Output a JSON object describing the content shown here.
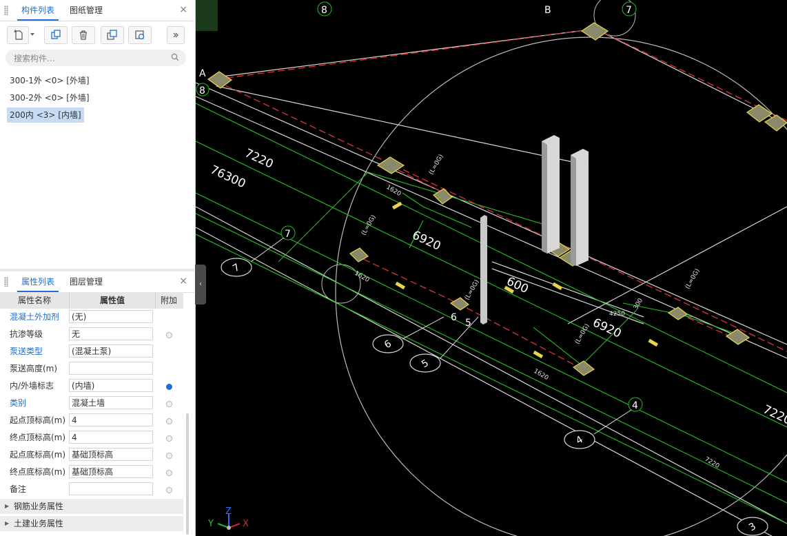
{
  "component_panel": {
    "tabs": [
      "构件列表",
      "图纸管理"
    ],
    "active_tab": 0,
    "close_icon": "×",
    "toolbar": [
      "new-component-icon",
      "dropdown-arrow-icon",
      "copy-icon",
      "delete-icon",
      "duplicate-layer-icon",
      "refresh-icon",
      "more-icon"
    ],
    "search_placeholder": "搜索构件...",
    "items": [
      {
        "label": "300-1外 <0> [外墙]",
        "selected": false
      },
      {
        "label": "300-2外 <0> [外墙]",
        "selected": false
      },
      {
        "label": "200内 <3> [内墙]",
        "selected": true
      }
    ]
  },
  "property_panel": {
    "tabs": [
      "属性列表",
      "图层管理"
    ],
    "active_tab": 0,
    "close_icon": "×",
    "columns": [
      "属性名称",
      "属性值",
      "附加"
    ],
    "rows": [
      {
        "name": "混凝土外加剂",
        "value": "(无)",
        "blue": true,
        "dot": "none"
      },
      {
        "name": "抗渗等级",
        "value": "无",
        "blue": false,
        "dot": "off"
      },
      {
        "name": "泵送类型",
        "value": "(混凝土泵)",
        "blue": true,
        "dot": "none"
      },
      {
        "name": "泵送高度(m)",
        "value": "",
        "blue": false,
        "dot": "none"
      },
      {
        "name": "内/外墙标志",
        "value": "(内墙)",
        "blue": false,
        "dot": "on"
      },
      {
        "name": "类别",
        "value": "混凝土墙",
        "blue": true,
        "dot": "off"
      },
      {
        "name": "起点顶标高(m)",
        "value": "4",
        "blue": false,
        "dot": "off"
      },
      {
        "name": "终点顶标高(m)",
        "value": "4",
        "blue": false,
        "dot": "off"
      },
      {
        "name": "起点底标高(m)",
        "value": "基础顶标高",
        "blue": false,
        "dot": "off"
      },
      {
        "name": "终点底标高(m)",
        "value": "基础顶标高",
        "blue": false,
        "dot": "off"
      },
      {
        "name": "备注",
        "value": "",
        "blue": false,
        "dot": "off"
      }
    ],
    "groups": [
      "钢筋业务属性",
      "土建业务属性"
    ]
  },
  "viewport": {
    "axis_labels": {
      "a": "A",
      "b": "B",
      "n8_top": "8",
      "n8_left": "8",
      "n7_top": "7",
      "n7_mid": "7",
      "n4": "4",
      "n6": "6",
      "n5": "5"
    },
    "axis_bubbles": {
      "b7": "7",
      "b6": "6",
      "b5": "5",
      "b4": "4",
      "b3": "3"
    },
    "dims": {
      "d7220a": "7220",
      "d76300": "76300",
      "d6920a": "6920",
      "d600": "600",
      "d6920b": "6920",
      "d7220b": "7220"
    },
    "gizmo": {
      "x": "X",
      "y": "Y",
      "z": "Z"
    },
    "colors": {
      "accent": "#1f6fd6",
      "grid_green": "#22c41e",
      "wall_red": "#e0323a",
      "column_yellow": "#e6d44a"
    }
  }
}
